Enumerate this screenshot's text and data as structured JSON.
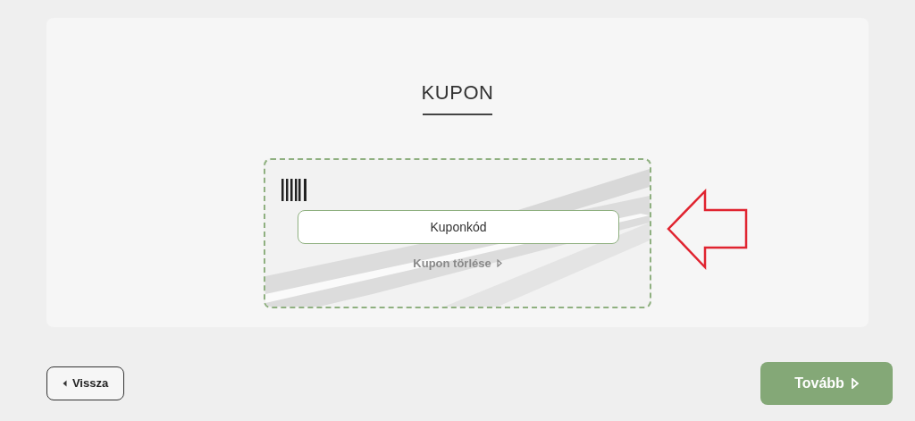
{
  "title": "KUPON",
  "coupon": {
    "placeholder": "Kuponkód",
    "clear_link": "Kupon törlése"
  },
  "buttons": {
    "back": "Vissza",
    "next": "Tovább"
  }
}
